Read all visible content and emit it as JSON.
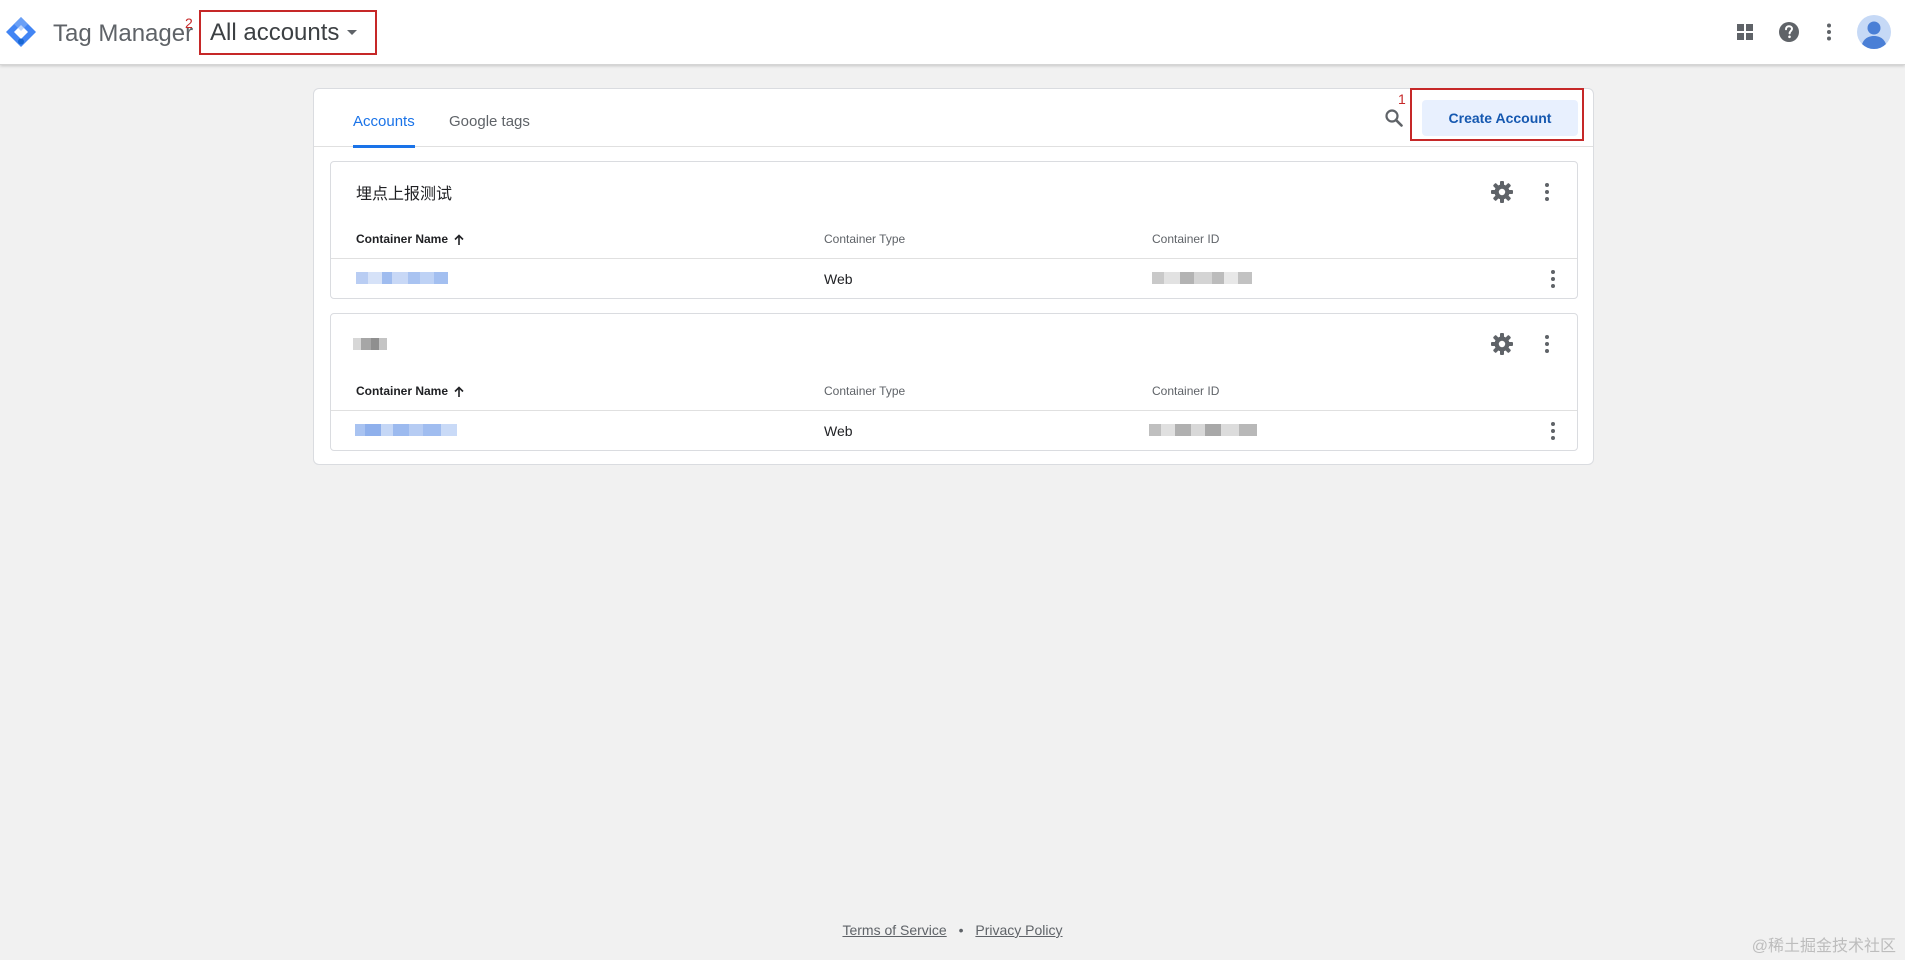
{
  "header": {
    "app_title": "Tag Manager",
    "annotation_2": "2",
    "account_switcher": "All accounts"
  },
  "tabs": [
    {
      "label": "Accounts",
      "active": true
    },
    {
      "label": "Google tags",
      "active": false
    }
  ],
  "toolbar": {
    "annotation_1": "1",
    "create_account_label": "Create Account"
  },
  "columns": {
    "name": "Container Name",
    "type": "Container Type",
    "id": "Container ID"
  },
  "accounts": [
    {
      "name": "埋点上报测试",
      "containers": [
        {
          "type": "Web"
        }
      ]
    },
    {
      "name": "",
      "containers": [
        {
          "type": "Web"
        }
      ]
    }
  ],
  "footer": {
    "terms": "Terms of Service",
    "separator": "•",
    "privacy": "Privacy Policy"
  },
  "watermark": "@稀土掘金技术社区",
  "colors": {
    "accent_blue": "#1a73e8",
    "annotation_red": "#c62828",
    "background": "#f1f1f1"
  }
}
